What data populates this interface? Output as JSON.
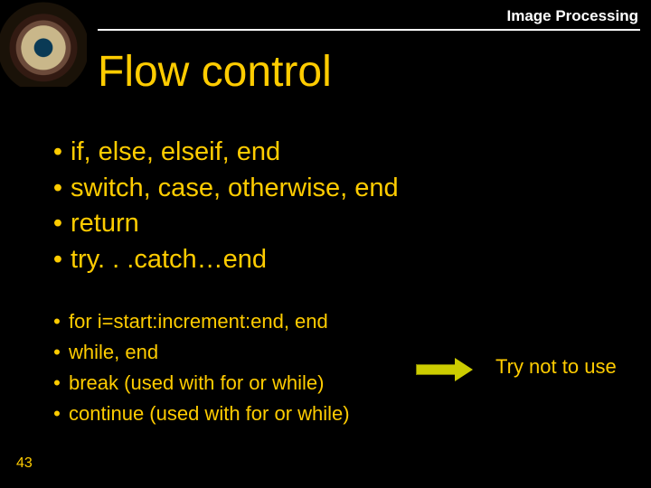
{
  "header": {
    "label": "Image Processing"
  },
  "title": "Flow control",
  "group1": [
    "if, else, elseif, end",
    "switch, case, otherwise, end",
    "return",
    "try. . .catch…end"
  ],
  "group2": [
    "for i=start:increment:end, end",
    "while, end",
    "break (used with for or while)",
    "continue (used with for or while)"
  ],
  "note": "Try not to use",
  "page": "43"
}
